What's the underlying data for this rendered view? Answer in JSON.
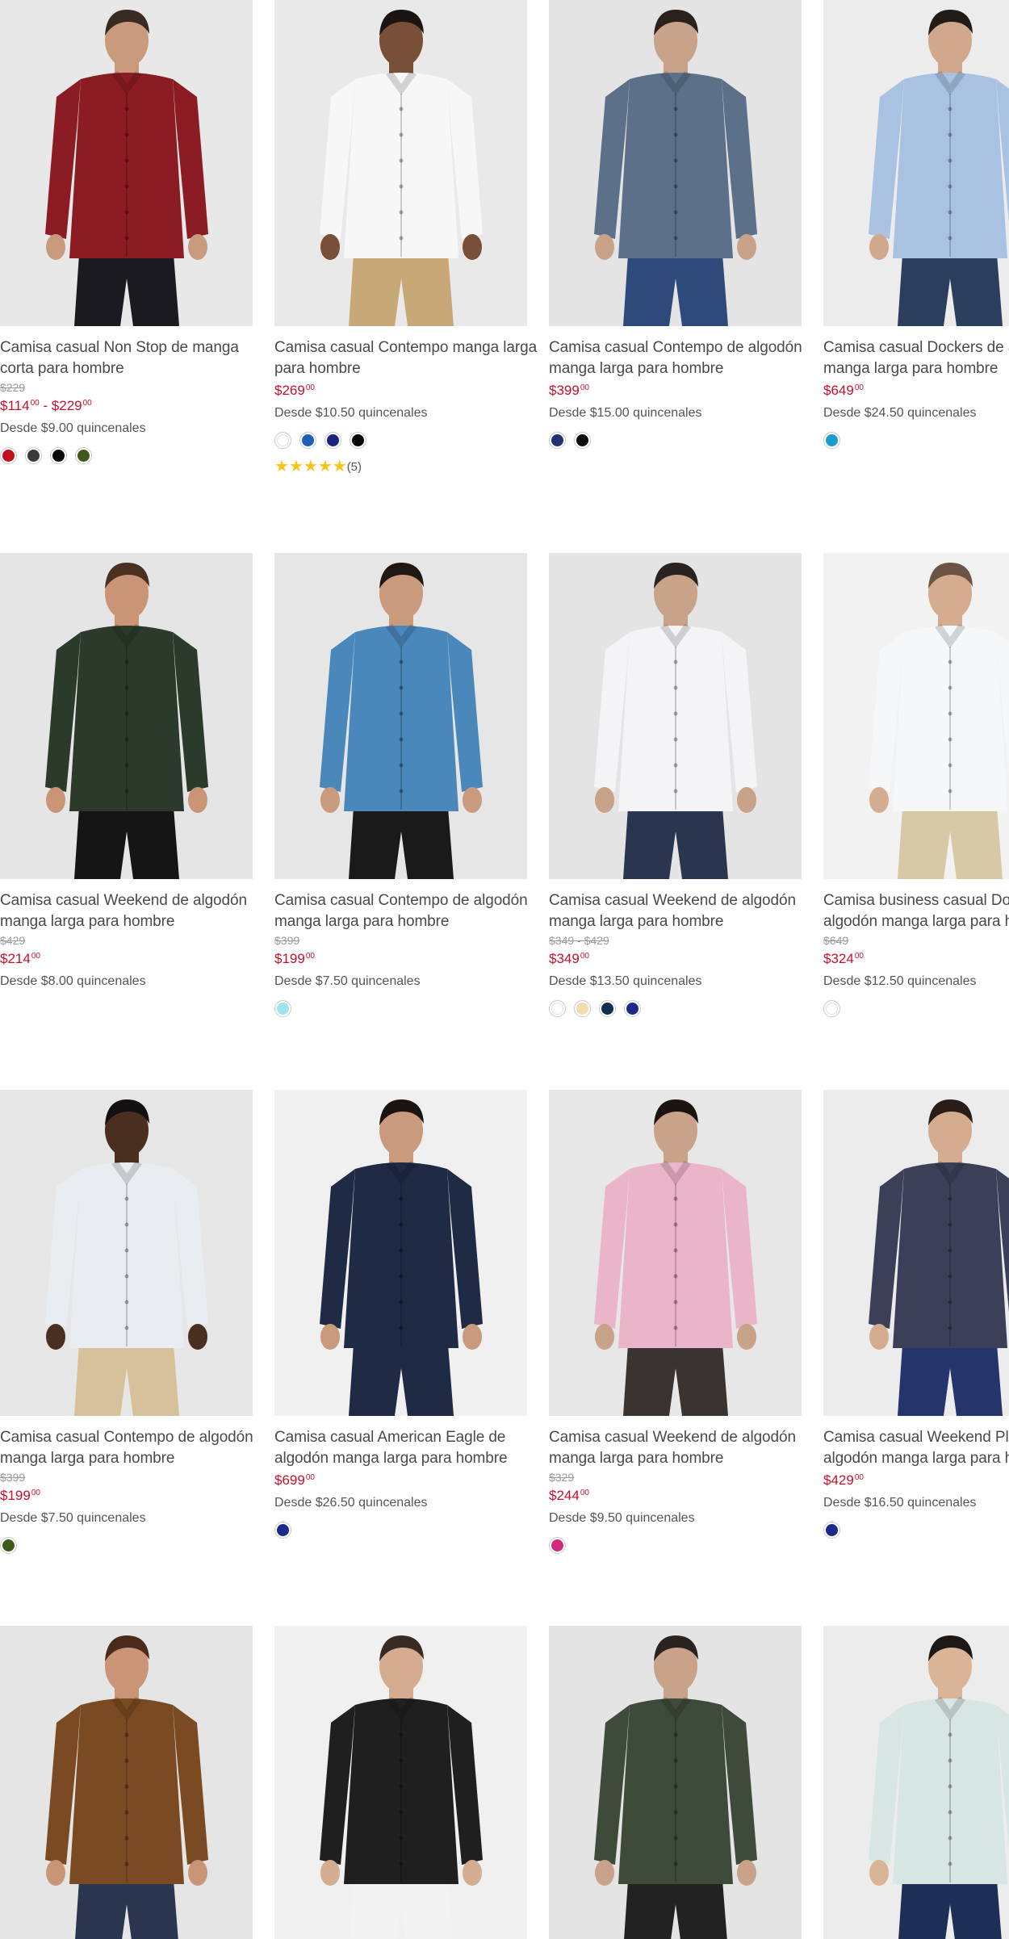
{
  "products": [
    {
      "title": "Camisa casual Non Stop de manga corta para hombre",
      "old_price": "$229",
      "price": "$114",
      "price_cents": "00",
      "price_to": "$229",
      "price_to_cents": "00",
      "installment": "Desde $9.00 quincenales",
      "swatches": [
        "#c0101a",
        "#3a3a3a",
        "#0a0a0a",
        "#3d5a1a"
      ],
      "shirt": "#8c1c24",
      "pants": "#1b1b1f",
      "skin": "#c99a7c",
      "bg": "#e8e8e8",
      "hair": "#3a2b22"
    },
    {
      "title": "Camisa casual Contempo manga larga para hombre",
      "price": "$269",
      "price_cents": "00",
      "installment": "Desde $10.50 quincenales",
      "swatches": [
        "#ffffff",
        "#1f5fb8",
        "#1a237e",
        "#0a0a0a"
      ],
      "rating_count": "(5)",
      "shirt": "#f7f7f7",
      "pants": "#c9a877",
      "skin": "#7a4f37",
      "bg": "#e9e9e9",
      "hair": "#1b1410"
    },
    {
      "title": "Camisa casual Contempo de algodón manga larga para hombre",
      "price": "$399",
      "price_cents": "00",
      "installment": "Desde $15.00 quincenales",
      "swatches": [
        "#233273",
        "#0a0a0a"
      ],
      "shirt": "#5c7189",
      "pants": "#2d4a7a",
      "skin": "#c9a28a",
      "bg": "#e4e4e4",
      "hair": "#2b211c"
    },
    {
      "title": "Camisa casual Dockers de algodón manga larga para hombre",
      "price": "$649",
      "price_cents": "00",
      "installment": "Desde $24.50 quincenales",
      "swatches": [
        "#1a9cd0"
      ],
      "shirt": "#a9c2e2",
      "pants": "#2c3e5e",
      "skin": "#d0a88c",
      "bg": "#ececec",
      "hair": "#231b16"
    },
    {
      "title": "Camisa casual Weekend de algodón manga larga para hombre",
      "old_price": "$429",
      "price": "$214",
      "price_cents": "00",
      "installment": "Desde $8.00 quincenales",
      "swatches": [],
      "shirt": "#2b3a2a",
      "pants": "#151515",
      "skin": "#c99576",
      "bg": "#e5e5e5",
      "hair": "#4a3020"
    },
    {
      "title": "Camisa casual Contempo de algodón manga larga para hombre",
      "old_price": "$399",
      "price": "$199",
      "price_cents": "00",
      "installment": "Desde $7.50 quincenales",
      "swatches": [
        "#9fe3ee"
      ],
      "shirt": "#4a87bb",
      "pants": "#1a1a1a",
      "skin": "#c99a7c",
      "bg": "#e6e6e6",
      "hair": "#1e1814"
    },
    {
      "title": "Camisa casual Weekend de algodón manga larga para hombre",
      "old_price": "$349 - $429",
      "price": "$349",
      "price_cents": "00",
      "installment": "Desde $13.50 quincenales",
      "swatches": [
        "#ffffff",
        "#f2dcae",
        "#0d2f52",
        "#1b2a8c"
      ],
      "shirt": "#f4f4f6",
      "pants": "#2a3650",
      "skin": "#c9a28a",
      "bg": "#e4e4e4",
      "hair": "#2a2320"
    },
    {
      "title": "Camisa business casual Dockers de algodón manga larga para hombre",
      "old_price": "$649",
      "price": "$324",
      "price_cents": "00",
      "installment": "Desde $12.50 quincenales",
      "swatches": [
        "#ffffff"
      ],
      "shirt": "#f6f7f9",
      "pants": "#d8c9a6",
      "skin": "#d4ad90",
      "bg": "#f2f2f2",
      "hair": "#6b5443"
    },
    {
      "title": "Camisa casual Contempo de algodón manga larga para hombre",
      "old_price": "$399",
      "price": "$199",
      "price_cents": "00",
      "installment": "Desde $7.50 quincenales",
      "swatches": [
        "#3d5a1a"
      ],
      "shirt": "#e9edf0",
      "pants": "#d7c19a",
      "skin": "#4a2e20",
      "bg": "#e6e6e6",
      "hair": "#121010"
    },
    {
      "title": "Camisa casual American Eagle de algodón manga larga para hombre",
      "price": "$699",
      "price_cents": "00",
      "installment": "Desde $26.50 quincenales",
      "swatches": [
        "#1b2a8c"
      ],
      "shirt": "#1f2a44",
      "pants": "#1f2a44",
      "skin": "#c99a7c",
      "bg": "#f0f0f0",
      "hair": "#1b1410"
    },
    {
      "title": "Camisa casual Weekend de algodón manga larga para hombre",
      "old_price": "$329",
      "price": "$244",
      "price_cents": "00",
      "installment": "Desde $9.50 quincenales",
      "swatches": [
        "#d42a7c"
      ],
      "shirt": "#eab5c9",
      "pants": "#3a3430",
      "skin": "#c9a28a",
      "bg": "#e7e7e7",
      "hair": "#1b1410"
    },
    {
      "title": "Camisa casual Weekend Plus de algodón manga larga para hombre",
      "price": "$429",
      "price_cents": "00",
      "installment": "Desde $16.50 quincenales",
      "swatches": [
        "#1b2a8c"
      ],
      "shirt": "#3b4058",
      "pants": "#24356b",
      "skin": "#d4ad90",
      "bg": "#ececec",
      "hair": "#2a1d16"
    },
    {
      "title": "",
      "price": "",
      "installment": "",
      "swatches": [],
      "shirt": "#7a4a22",
      "pants": "#2a3650",
      "skin": "#c99576",
      "bg": "#e5e5e5",
      "hair": "#4a2a1a"
    },
    {
      "title": "",
      "price": "",
      "installment": "",
      "swatches": [],
      "shirt": "#1f1f1f",
      "pants": "#f2f2f2",
      "skin": "#d4ad90",
      "bg": "#f0f0f0",
      "hair": "#3a2b22"
    },
    {
      "title": "",
      "price": "",
      "installment": "",
      "swatches": [],
      "shirt": "#3e4a3a",
      "pants": "#222222",
      "skin": "#c9a28a",
      "bg": "#e4e4e4",
      "hair": "#2a2320"
    },
    {
      "title": "",
      "price": "",
      "installment": "",
      "swatches": [],
      "shirt": "#d7e6e2",
      "pants": "#1e2f55",
      "skin": "#d9b496",
      "bg": "#ececec",
      "hair": "#1e1814"
    }
  ]
}
